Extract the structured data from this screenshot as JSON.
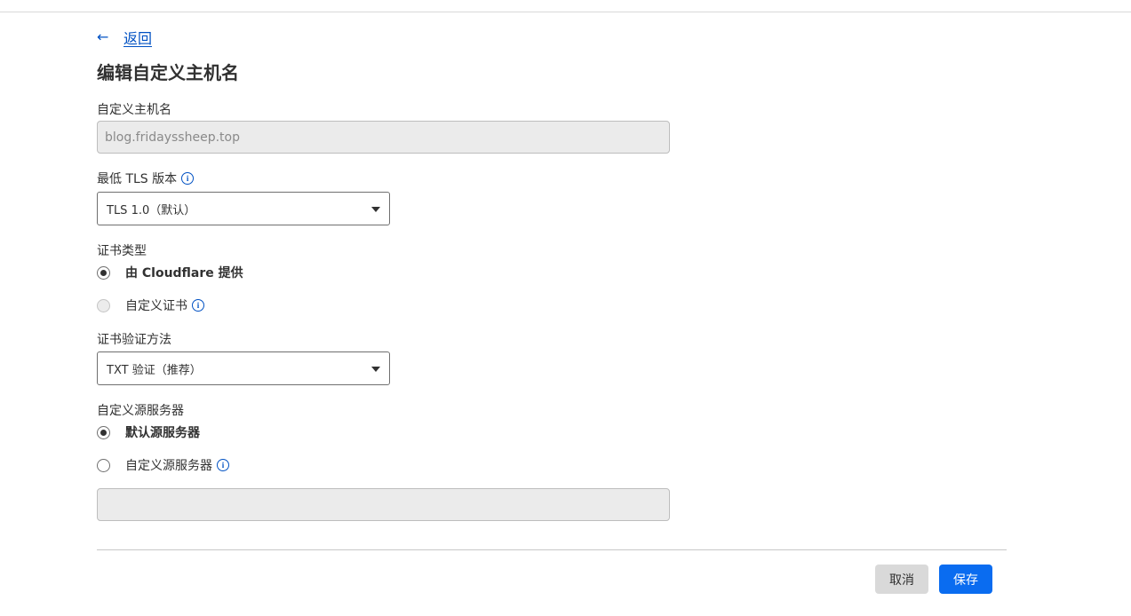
{
  "header": {
    "back_arrow": "←",
    "back_label": "返回",
    "title": "编辑自定义主机名"
  },
  "form": {
    "hostname": {
      "label": "自定义主机名",
      "value": "blog.fridayssheep.top"
    },
    "min_tls": {
      "label": "最低 TLS 版本",
      "info_icon": "info-icon",
      "selected": "TLS 1.0（默认）"
    },
    "certificate_type": {
      "label": "证书类型",
      "options": [
        {
          "label": "由 Cloudflare 提供",
          "checked": true
        },
        {
          "label": "自定义证书",
          "checked": false,
          "info_icon": "info-icon"
        }
      ]
    },
    "validation_method": {
      "label": "证书验证方法",
      "selected": "TXT 验证（推荐）"
    },
    "origin_server": {
      "label": "自定义源服务器",
      "options": [
        {
          "label": "默认源服务器",
          "checked": true
        },
        {
          "label": "自定义源服务器",
          "checked": false,
          "info_icon": "info-icon"
        }
      ],
      "custom_value": ""
    }
  },
  "footer": {
    "cancel_label": "取消",
    "save_label": "保存"
  },
  "colors": {
    "link": "#0051c3",
    "primary_button": "#0a6cf0",
    "secondary_button": "#d9d9d9",
    "disabled_field": "#ebebeb"
  }
}
